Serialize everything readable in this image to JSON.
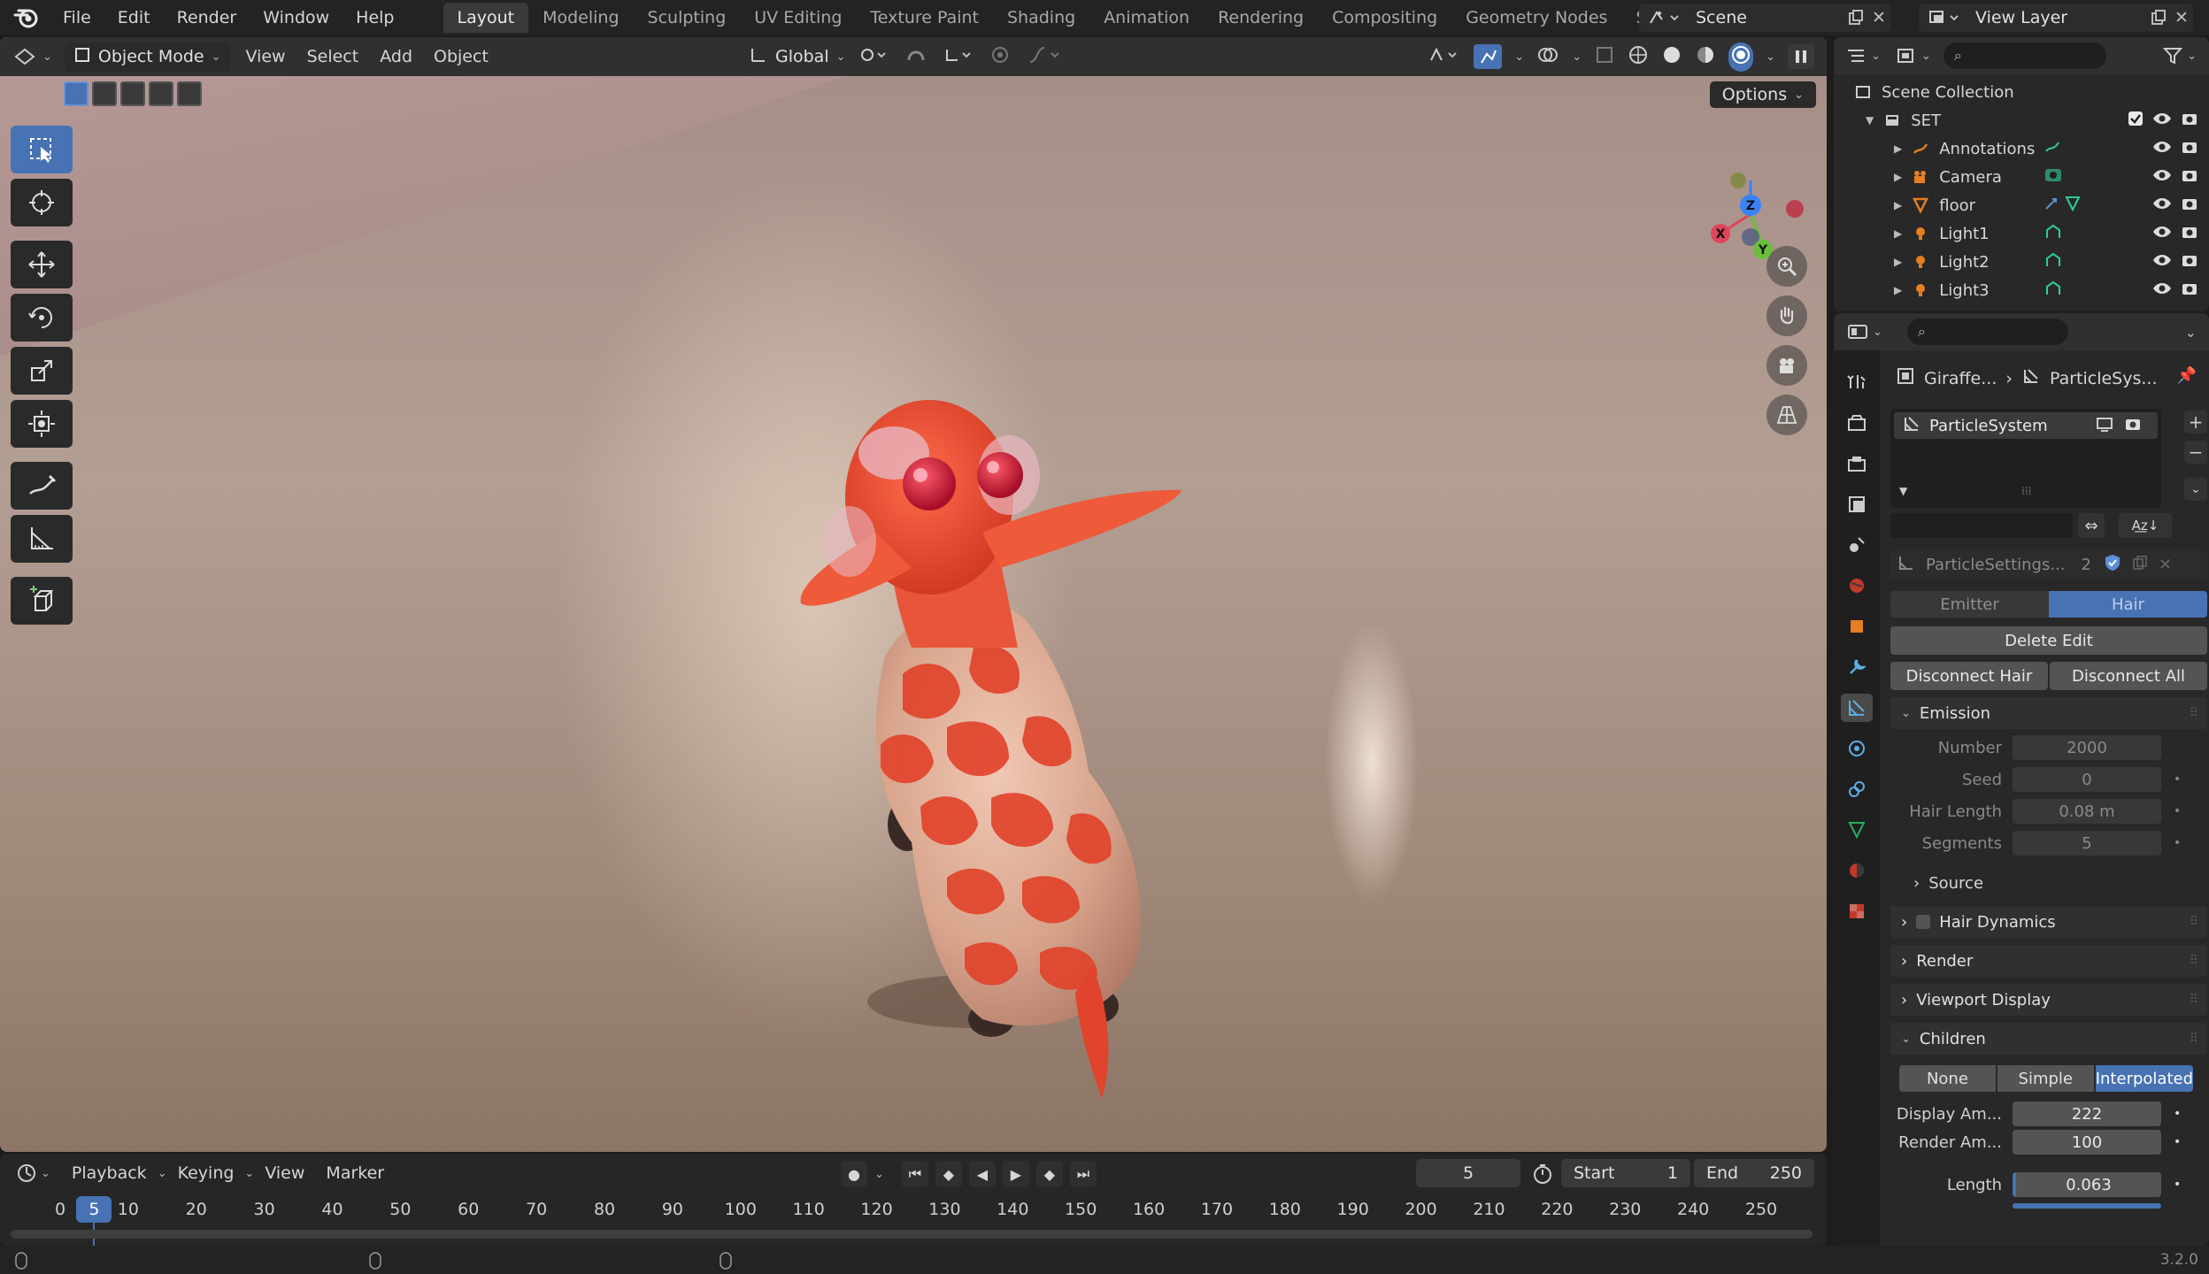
{
  "app": {
    "menus": [
      "File",
      "Edit",
      "Render",
      "Window",
      "Help"
    ],
    "workspaces": [
      "Layout",
      "Modeling",
      "Sculpting",
      "UV Editing",
      "Texture Paint",
      "Shading",
      "Animation",
      "Rendering",
      "Compositing",
      "Geometry Nodes",
      "Scripting"
    ],
    "active_workspace": "Layout",
    "scene": "Scene",
    "view_layer": "View Layer",
    "version": "3.2.0"
  },
  "viewport": {
    "mode": "Object Mode",
    "menus": [
      "View",
      "Select",
      "Add",
      "Object"
    ],
    "orientation": "Global",
    "options_label": "Options",
    "gizmo_axes": {
      "x": "X",
      "y": "Y",
      "z": "Z"
    },
    "tools": [
      "select-box",
      "cursor",
      "move",
      "rotate",
      "scale",
      "transform",
      "annotate",
      "measure",
      "add-cube"
    ],
    "colors": {
      "active": "#4772b3"
    }
  },
  "timeline": {
    "menus": [
      "Playback",
      "Keying",
      "View",
      "Marker"
    ],
    "current_frame": "5",
    "start_label": "Start",
    "start": "1",
    "end_label": "End",
    "end": "250",
    "ticks": [
      "0",
      "10",
      "20",
      "30",
      "40",
      "50",
      "60",
      "70",
      "80",
      "90",
      "100",
      "110",
      "120",
      "130",
      "140",
      "150",
      "160",
      "170",
      "180",
      "190",
      "200",
      "210",
      "220",
      "230",
      "240",
      "250"
    ]
  },
  "outliner": {
    "root": "Scene Collection",
    "collection": "SET",
    "items": [
      {
        "name": "Annotations",
        "icon": "annotation-icon"
      },
      {
        "name": "Camera",
        "icon": "camera-icon"
      },
      {
        "name": "floor",
        "icon": "mesh-icon"
      },
      {
        "name": "Light1",
        "icon": "light-icon"
      },
      {
        "name": "Light2",
        "icon": "light-icon"
      },
      {
        "name": "Light3",
        "icon": "light-icon"
      }
    ]
  },
  "properties": {
    "breadcrumb_object": "Giraffe...",
    "breadcrumb_system": "ParticleSys...",
    "particle_system": "ParticleSystem",
    "settings_name": "ParticleSettings...",
    "settings_users": "2",
    "type_options": [
      "Emitter",
      "Hair"
    ],
    "type_selected": "Hair",
    "delete_edit": "Delete Edit",
    "disconnect_hair": "Disconnect Hair",
    "disconnect_all": "Disconnect All",
    "emission": {
      "title": "Emission",
      "number_label": "Number",
      "number": "2000",
      "seed_label": "Seed",
      "seed": "0",
      "hair_length_label": "Hair Length",
      "hair_length": "0.08 m",
      "segments_label": "Segments",
      "segments": "5",
      "source": "Source"
    },
    "hair_dynamics": "Hair Dynamics",
    "render": "Render",
    "viewport_display": "Viewport Display",
    "children": {
      "title": "Children",
      "options": [
        "None",
        "Simple",
        "Interpolated"
      ],
      "selected": "Interpolated",
      "display_amount_label": "Display Am...",
      "display_amount": "222",
      "render_amount_label": "Render Am...",
      "render_amount": "100",
      "length_label": "Length",
      "length": "0.063"
    }
  }
}
